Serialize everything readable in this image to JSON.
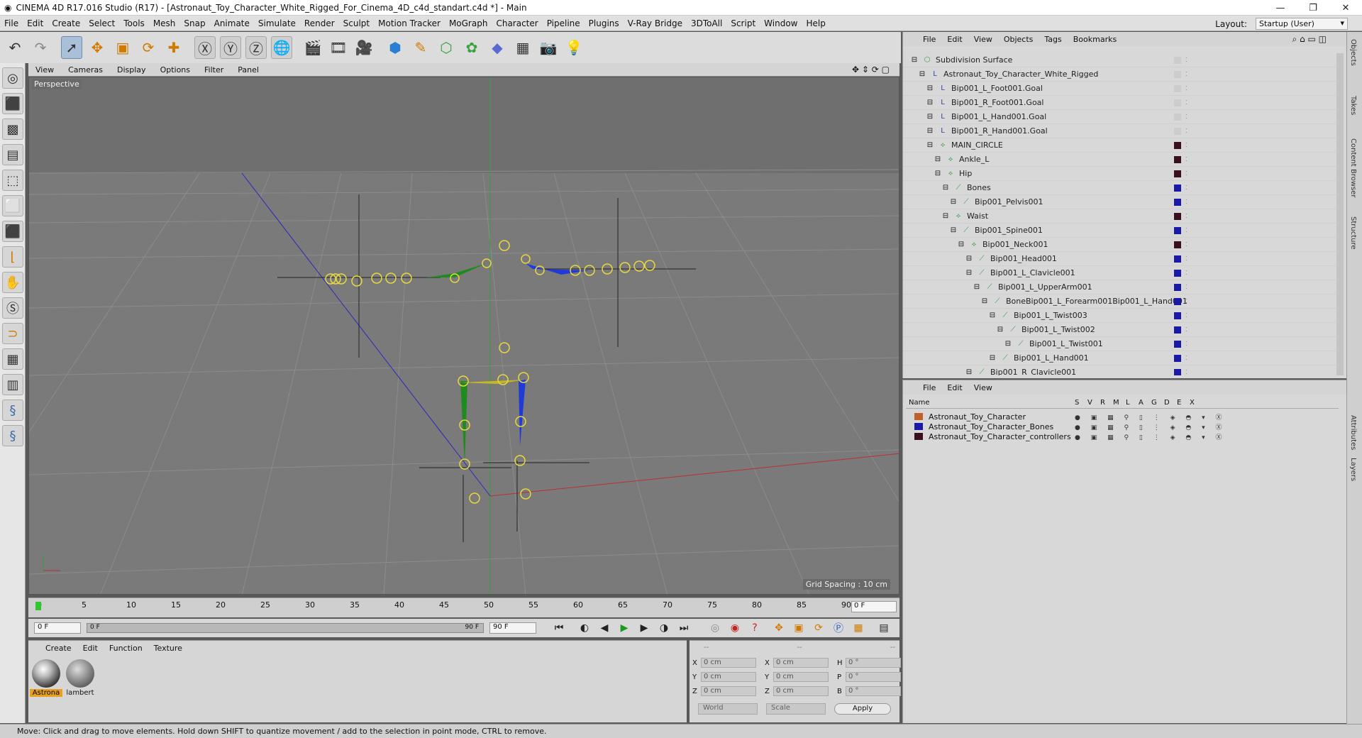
{
  "window": {
    "title": "CINEMA 4D R17.016 Studio (R17) - [Astronaut_Toy_Character_White_Rigged_For_Cinema_4D_c4d_standart.c4d *] - Main"
  },
  "menu": [
    "File",
    "Edit",
    "Create",
    "Select",
    "Tools",
    "Mesh",
    "Snap",
    "Animate",
    "Simulate",
    "Render",
    "Sculpt",
    "Motion Tracker",
    "MoGraph",
    "Character",
    "Pipeline",
    "Plugins",
    "V-Ray Bridge",
    "3DToAll",
    "Script",
    "Window",
    "Help"
  ],
  "layout": {
    "label": "Layout:",
    "value": "Startup (User)"
  },
  "viewport": {
    "menu": [
      "View",
      "Cameras",
      "Display",
      "Options",
      "Filter",
      "Panel"
    ],
    "label": "Perspective",
    "grid_spacing": "Grid Spacing : 10 cm"
  },
  "timeline": {
    "ticks": [
      "0",
      "5",
      "10",
      "15",
      "20",
      "25",
      "30",
      "35",
      "40",
      "45",
      "50",
      "55",
      "60",
      "65",
      "70",
      "75",
      "80",
      "85",
      "90"
    ],
    "current_frame": "0 F",
    "start": "0 F",
    "slider_start": "0 F",
    "slider_end": "90 F",
    "end": "90 F"
  },
  "materials": {
    "menu": [
      "Create",
      "Edit",
      "Function",
      "Texture"
    ],
    "items": [
      {
        "label": "Astrona"
      },
      {
        "label": "lambert"
      }
    ]
  },
  "attributes": {
    "header": [
      "--",
      "--",
      "--"
    ],
    "rows": [
      {
        "a": "X",
        "av": "0 cm",
        "b": "X",
        "bv": "0 cm",
        "c": "H",
        "cv": "0 °"
      },
      {
        "a": "Y",
        "av": "0 cm",
        "b": "Y",
        "bv": "0 cm",
        "c": "P",
        "cv": "0 °"
      },
      {
        "a": "Z",
        "av": "0 cm",
        "b": "Z",
        "bv": "0 cm",
        "c": "B",
        "cv": "0 °"
      }
    ],
    "coord": "World",
    "mode": "Scale",
    "apply": "Apply"
  },
  "objects": {
    "menu": [
      "File",
      "Edit",
      "View",
      "Objects",
      "Tags",
      "Bookmarks"
    ],
    "items": [
      {
        "name": "Subdivision Surface",
        "indent": 0,
        "color": "#cccccc"
      },
      {
        "name": "Astronaut_Toy_Character_White_Rigged",
        "indent": 1,
        "color": "#cccccc"
      },
      {
        "name": "Bip001_L_Foot001.Goal",
        "indent": 2,
        "color": "#cccccc"
      },
      {
        "name": "Bip001_R_Foot001.Goal",
        "indent": 2,
        "color": "#cccccc"
      },
      {
        "name": "Bip001_L_Hand001.Goal",
        "indent": 2,
        "color": "#cccccc"
      },
      {
        "name": "Bip001_R_Hand001.Goal",
        "indent": 2,
        "color": "#cccccc"
      },
      {
        "name": "MAIN_CIRCLE",
        "indent": 2,
        "color": "#3a1020"
      },
      {
        "name": "Ankle_L",
        "indent": 3,
        "color": "#3a1020"
      },
      {
        "name": "Hip",
        "indent": 3,
        "color": "#3a1020"
      },
      {
        "name": "Bones",
        "indent": 4,
        "color": "#1a1aa8"
      },
      {
        "name": "Bip001_Pelvis001",
        "indent": 5,
        "color": "#1a1aa8"
      },
      {
        "name": "Waist",
        "indent": 4,
        "color": "#3a1020"
      },
      {
        "name": "Bip001_Spine001",
        "indent": 5,
        "color": "#1a1aa8"
      },
      {
        "name": "Bip001_Neck001",
        "indent": 6,
        "color": "#3a1020"
      },
      {
        "name": "Bip001_Head001",
        "indent": 7,
        "color": "#1a1aa8"
      },
      {
        "name": "Bip001_L_Clavicle001",
        "indent": 7,
        "color": "#1a1aa8"
      },
      {
        "name": "Bip001_L_UpperArm001",
        "indent": 8,
        "color": "#1a1aa8"
      },
      {
        "name": "BoneBip001_L_Forearm001Bip001_L_Hand001",
        "indent": 9,
        "color": "#1a1aa8"
      },
      {
        "name": "Bip001_L_Twist003",
        "indent": 10,
        "color": "#1a1aa8"
      },
      {
        "name": "Bip001_L_Twist002",
        "indent": 11,
        "color": "#1a1aa8"
      },
      {
        "name": "Bip001_L_Twist001",
        "indent": 12,
        "color": "#1a1aa8"
      },
      {
        "name": "Bip001_L_Hand001",
        "indent": 10,
        "color": "#1a1aa8"
      },
      {
        "name": "Bip001_R_Clavicle001",
        "indent": 7,
        "color": "#1a1aa8"
      }
    ]
  },
  "layers": {
    "menu": [
      "File",
      "Edit",
      "View"
    ],
    "columns": [
      "Name",
      "S",
      "V",
      "R",
      "M",
      "L",
      "A",
      "G",
      "D",
      "E",
      "X"
    ],
    "items": [
      {
        "name": "Astronaut_Toy_Character",
        "color": "#c0602a"
      },
      {
        "name": "Astronaut_Toy_Character_Bones",
        "color": "#1a1aa8"
      },
      {
        "name": "Astronaut_Toy_Character_controllers",
        "color": "#3a1020"
      }
    ]
  },
  "right_tabs": [
    "Objects",
    "Takes",
    "Content Browser",
    "Structure",
    "Attributes",
    "Layers"
  ],
  "status": "Move: Click and drag to move elements. Hold down SHIFT to quantize movement / add to the selection in point mode, CTRL to remove."
}
